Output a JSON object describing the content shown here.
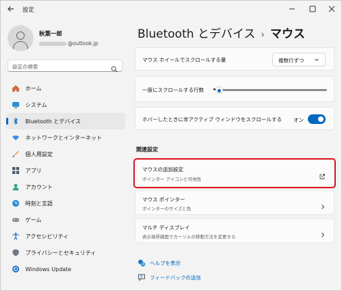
{
  "window": {
    "title": "設定"
  },
  "profile": {
    "name": "秋葉一郎",
    "email_domain": "@outlook.jp"
  },
  "search": {
    "placeholder": "設定の検索"
  },
  "sidebar": {
    "items": [
      {
        "label": "ホーム",
        "icon": "home-icon",
        "active": false
      },
      {
        "label": "システム",
        "icon": "system-icon",
        "active": false
      },
      {
        "label": "Bluetooth とデバイス",
        "icon": "bluetooth-icon",
        "active": true
      },
      {
        "label": "ネットワークとインターネット",
        "icon": "network-icon",
        "active": false
      },
      {
        "label": "個人用設定",
        "icon": "personalization-icon",
        "active": false
      },
      {
        "label": "アプリ",
        "icon": "apps-icon",
        "active": false
      },
      {
        "label": "アカウント",
        "icon": "account-icon",
        "active": false
      },
      {
        "label": "時刻と言語",
        "icon": "time-language-icon",
        "active": false
      },
      {
        "label": "ゲーム",
        "icon": "gaming-icon",
        "active": false
      },
      {
        "label": "アクセシビリティ",
        "icon": "accessibility-icon",
        "active": false
      },
      {
        "label": "プライバシーとセキュリティ",
        "icon": "privacy-icon",
        "active": false
      },
      {
        "label": "Windows Update",
        "icon": "windows-update-icon",
        "active": false
      }
    ]
  },
  "header": {
    "breadcrumb_parent": "Bluetooth とデバイス",
    "separator": "›",
    "breadcrumb_current": "マウス"
  },
  "settings": {
    "scroll_wheel_label": "マウス ホイールでスクロールする量",
    "scroll_wheel_value": "複数行ずつ",
    "lines_label": "一度にスクロールする行数",
    "lines_slider_fraction": 0.0,
    "inactive_scroll_label": "ホバーしたときに非アクティブ ウィンドウをスクロールする",
    "inactive_scroll_state": "オン"
  },
  "related": {
    "heading": "関連設定",
    "items": [
      {
        "title": "マウスの追加設定",
        "subtitle": "ポインター アイコンと可視性",
        "icon": "external-link-icon",
        "highlighted": true
      },
      {
        "title": "マウス ポインター",
        "subtitle": "ポインターのサイズと色",
        "icon": "chevron-right-icon",
        "highlighted": false
      },
      {
        "title": "マルチ ディスプレイ",
        "subtitle": "表示境界線面でカーソルの移動方法を変更する",
        "icon": "chevron-right-icon",
        "highlighted": false
      }
    ]
  },
  "footer": {
    "help_label": "ヘルプを表示",
    "feedback_label": "フィードバックの送信"
  },
  "colors": {
    "accent": "#0067c0",
    "highlight_border": "#e3141f"
  }
}
